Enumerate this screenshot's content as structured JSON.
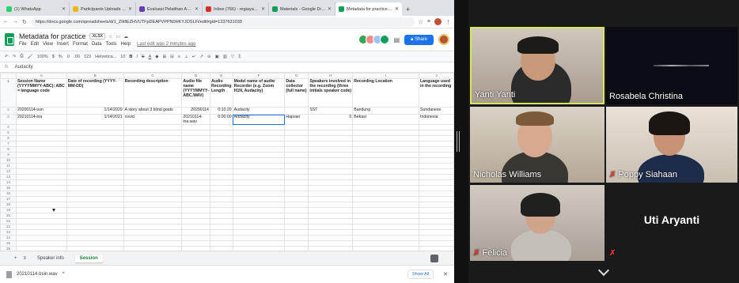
{
  "browser": {
    "tabs": [
      {
        "label": "(1) WhatsApp",
        "color": "#25d366"
      },
      {
        "label": "Participants Uploads - Goo",
        "color": "#f4b400"
      },
      {
        "label": "Evaluasi Pelatihan Audacity",
        "color": "#673ab7"
      },
      {
        "label": "Inbox (766) - regiayanti@...",
        "color": "#d93025"
      },
      {
        "label": "Materials - Google Drive",
        "color": "#0f9d58"
      },
      {
        "label": "Metadata for practice.xlsx",
        "color": "#0f9d58"
      }
    ],
    "new_tab": "+",
    "url": "https://docs.google.com/spreadsheets/d/1_ZIkfiEZHVUTFpDEAPVPPN0HKYJOSLFi/edit#gid=1337631030"
  },
  "doc": {
    "title": "Metadata for practice",
    "badge": ".XLSX",
    "menus": [
      "File",
      "Edit",
      "View",
      "Insert",
      "Format",
      "Data",
      "Tools",
      "Help"
    ],
    "last_edit": "Last edit was 2 minutes ago",
    "share": "Share"
  },
  "toolbar": {
    "zoom": "100%",
    "currency": "$",
    "percent": "%",
    "dec1": ".0",
    "dec2": ".00",
    "format": "123",
    "font": "Helvetica...",
    "size": "10",
    "bold": "B",
    "italic": "I",
    "strike": "S",
    "underline": "A"
  },
  "formula": {
    "fx": "fx",
    "value": "Audacity"
  },
  "sheet": {
    "columns": [
      "A",
      "B",
      "C",
      "D",
      "E",
      "F",
      "G",
      "H",
      "I",
      "J"
    ],
    "header": [
      "Session Name (YYYYMMYY-ABC): ABC = language code",
      "Date of recording (YYYY-MM-DD)",
      "Recording description",
      "Audio file name (YYYYMMYY-ABC.WAV)",
      "Audio Recording Length",
      "Model name of audio Recorder (e.g. Zoom H1N, Audacity)",
      "Data collector (full name)",
      "Speakers involved in the recording (three initials speaker code)",
      "Recording Location",
      "Language used in the recording"
    ],
    "rows": [
      [
        "20200114-sun",
        "1/14/2020",
        "A story about 3 blind goats",
        "20200114",
        "0:10:20",
        "Audacity",
        "",
        "SST",
        "Bandung",
        "Sundanese"
      ],
      [
        "20210114-ina",
        "1/14/2021",
        "covid",
        "20210114-ina.wav",
        "0:00:00",
        "Audacity",
        "Hapsari",
        "0",
        "Bekasi",
        "Indonesia"
      ]
    ],
    "row_numbers": [
      "1",
      "2",
      "3",
      "4",
      "5",
      "6",
      "7",
      "8",
      "9",
      "10",
      "11",
      "12",
      "13",
      "14",
      "15",
      "16",
      "17",
      "18",
      "19",
      "20",
      "21",
      "22",
      "23",
      "24",
      "25",
      "26",
      "27",
      "28"
    ]
  },
  "sheet_tabs": {
    "add": "+",
    "all": "≡",
    "tabs": [
      "Speaker info",
      "Session"
    ],
    "active": "Session"
  },
  "download": {
    "file": "20210114-bsin.wav",
    "show_all": "Show All",
    "close": "✕"
  },
  "participants": [
    {
      "name": "Yanti Yanti",
      "muted": false
    },
    {
      "name": "Rosabela Christina",
      "muted": false
    },
    {
      "name": "Nicholas Williams",
      "muted": false
    },
    {
      "name": "Poppy Siahaan",
      "muted": true
    },
    {
      "name": "Felicia",
      "muted": true
    },
    {
      "name": "Uti Aryanti",
      "muted": true
    }
  ],
  "colors": {
    "accent": "#1a73e8",
    "sheets_green": "#0f9d58",
    "active_speaker": "#d7e65a",
    "muted": "#e53935"
  }
}
